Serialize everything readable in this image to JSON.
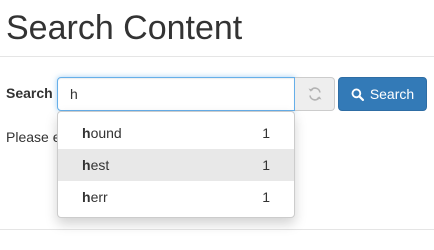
{
  "page": {
    "title": "Search Content"
  },
  "search": {
    "label": "Search",
    "query": "h",
    "button_label": "Search",
    "help_text": "Please e"
  },
  "suggestions": [
    {
      "match": "h",
      "rest": "ound",
      "count": "1"
    },
    {
      "match": "h",
      "rest": "est",
      "count": "1"
    },
    {
      "match": "h",
      "rest": "err",
      "count": "1"
    }
  ],
  "colors": {
    "primary_button": "#337ab7",
    "highlight_row": "#e8e8e8",
    "focus_ring": "#66afe9"
  },
  "icons": {
    "reset": "refresh-icon",
    "search": "search-icon"
  }
}
